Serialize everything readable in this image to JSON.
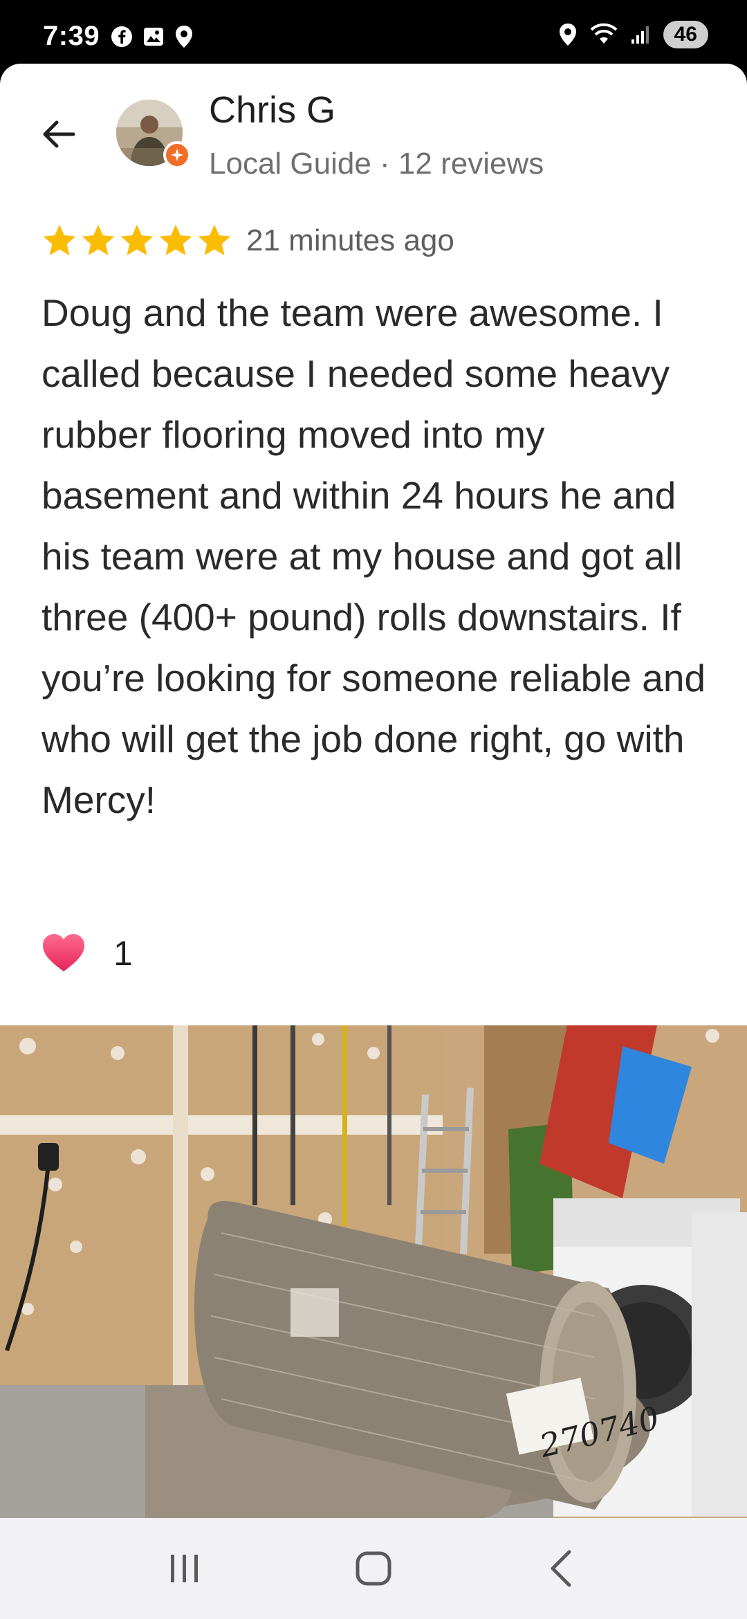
{
  "status_bar": {
    "time": "7:39",
    "left_icons": [
      "facebook-icon",
      "gallery-icon",
      "location-icon"
    ],
    "right_icons": [
      "location-icon",
      "wifi-icon",
      "signal-icon"
    ],
    "battery": "46"
  },
  "review": {
    "reviewer_name": "Chris G",
    "reviewer_meta": "Local Guide · 12 reviews",
    "rating": 5,
    "time_ago": "21 minutes ago",
    "text": "Doug and the team were awesome. I called because I needed some heavy rubber flooring moved into my basement and within 24 hours he and his team were at my house and got all three (400+ pound) rolls downstairs. If you’re looking for someone reliable and who will get the job done right, go with Mercy!",
    "reaction_icon": "heart-icon",
    "reaction_count": "1",
    "photo_label": "270740"
  },
  "colors": {
    "star": "#fbbc04",
    "badge": "#f06f28",
    "heart": "#f0436a"
  },
  "nav_bar": {
    "buttons": [
      "recent-apps-button",
      "home-button",
      "back-nav-button"
    ]
  }
}
